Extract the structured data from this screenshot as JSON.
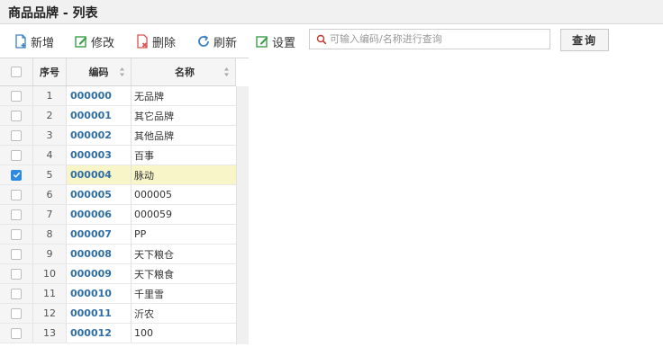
{
  "window": {
    "title": "商品品牌 - 列表"
  },
  "toolbar": {
    "add_label": "新增",
    "edit_label": "修改",
    "delete_label": "删除",
    "refresh_label": "刷新",
    "settings_label": "设置",
    "search_placeholder": "可输入编码/名称进行查询",
    "search_value": "",
    "query_label": "查询"
  },
  "table": {
    "columns": {
      "seq": "序号",
      "code": "编码",
      "name": "名称"
    },
    "rows": [
      {
        "seq": "1",
        "code": "000000",
        "name": "无品牌",
        "checked": false
      },
      {
        "seq": "2",
        "code": "000001",
        "name": "其它品牌",
        "checked": false
      },
      {
        "seq": "3",
        "code": "000002",
        "name": "其他品牌",
        "checked": false
      },
      {
        "seq": "4",
        "code": "000003",
        "name": "百事",
        "checked": false
      },
      {
        "seq": "5",
        "code": "000004",
        "name": "脉动",
        "checked": true
      },
      {
        "seq": "6",
        "code": "000005",
        "name": "000005",
        "checked": false
      },
      {
        "seq": "7",
        "code": "000006",
        "name": "000059",
        "checked": false
      },
      {
        "seq": "8",
        "code": "000007",
        "name": "PP",
        "checked": false
      },
      {
        "seq": "9",
        "code": "000008",
        "name": "天下粮仓",
        "checked": false
      },
      {
        "seq": "10",
        "code": "000009",
        "name": "天下粮食",
        "checked": false
      },
      {
        "seq": "11",
        "code": "000010",
        "name": "千里雪",
        "checked": false
      },
      {
        "seq": "12",
        "code": "000011",
        "name": "沂农",
        "checked": false
      },
      {
        "seq": "13",
        "code": "000012",
        "name": "100",
        "checked": false
      }
    ]
  },
  "colors": {
    "accent": "#2d8ae0",
    "code_text": "#2f6ea5",
    "selected_row": "#f8f5c9"
  }
}
